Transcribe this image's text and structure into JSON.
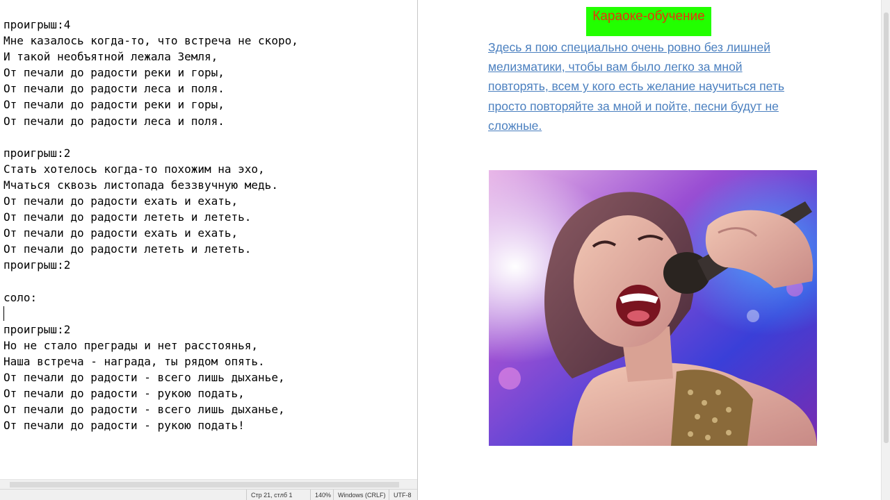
{
  "editor": {
    "lines": [
      "проигрыш:4",
      "Мне казалось когда-то, что встреча не скоро,",
      "И такой необъятной лежала Земля,",
      "От печали до радости реки и горы,",
      "От печали до радости леса и поля.",
      "От печали до радости реки и горы,",
      "От печали до радости леса и поля.",
      "",
      "проигрыш:2",
      "Стать хотелось когда-то похожим на эхо,",
      "Мчаться сквозь листопада беззвучную медь.",
      "От печали до радости ехать и ехать,",
      "От печали до радости лететь и лететь.",
      "От печали до радости ехать и ехать,",
      "От печали до радости лететь и лететь.",
      "проигрыш:2",
      "",
      "соло:",
      "",
      "проигрыш:2",
      "Но не стало преграды и нет расстоянья,",
      "Наша встреча - награда, ты рядом опять.",
      "От печали до радости - всего лишь дыханье,",
      "От печали до радости - рукою подать,",
      "От печали до радости - всего лишь дыханье,",
      "От печали до радости - рукою подать!"
    ],
    "caret_line": 19
  },
  "status": {
    "position": "Стр 21, стлб 1",
    "zoom": "140%",
    "line_endings": "Windows (CRLF)",
    "encoding": "UTF-8"
  },
  "document": {
    "title": "Караоке-обучение",
    "title_bg": "#22ff00",
    "title_color": "#e8320a",
    "paragraph_lines": [
      "Здесь я пою специально очень ровно без лишней",
      "мелизматики, чтобы вам было легко за мной",
      "повторять, всем у кого есть желание научиться петь",
      "просто повторяйте за мной и пойте, песни будут не",
      "сложные."
    ],
    "link_color": "#4a7fbf",
    "image_icon": "singer-with-microphone-photo"
  }
}
